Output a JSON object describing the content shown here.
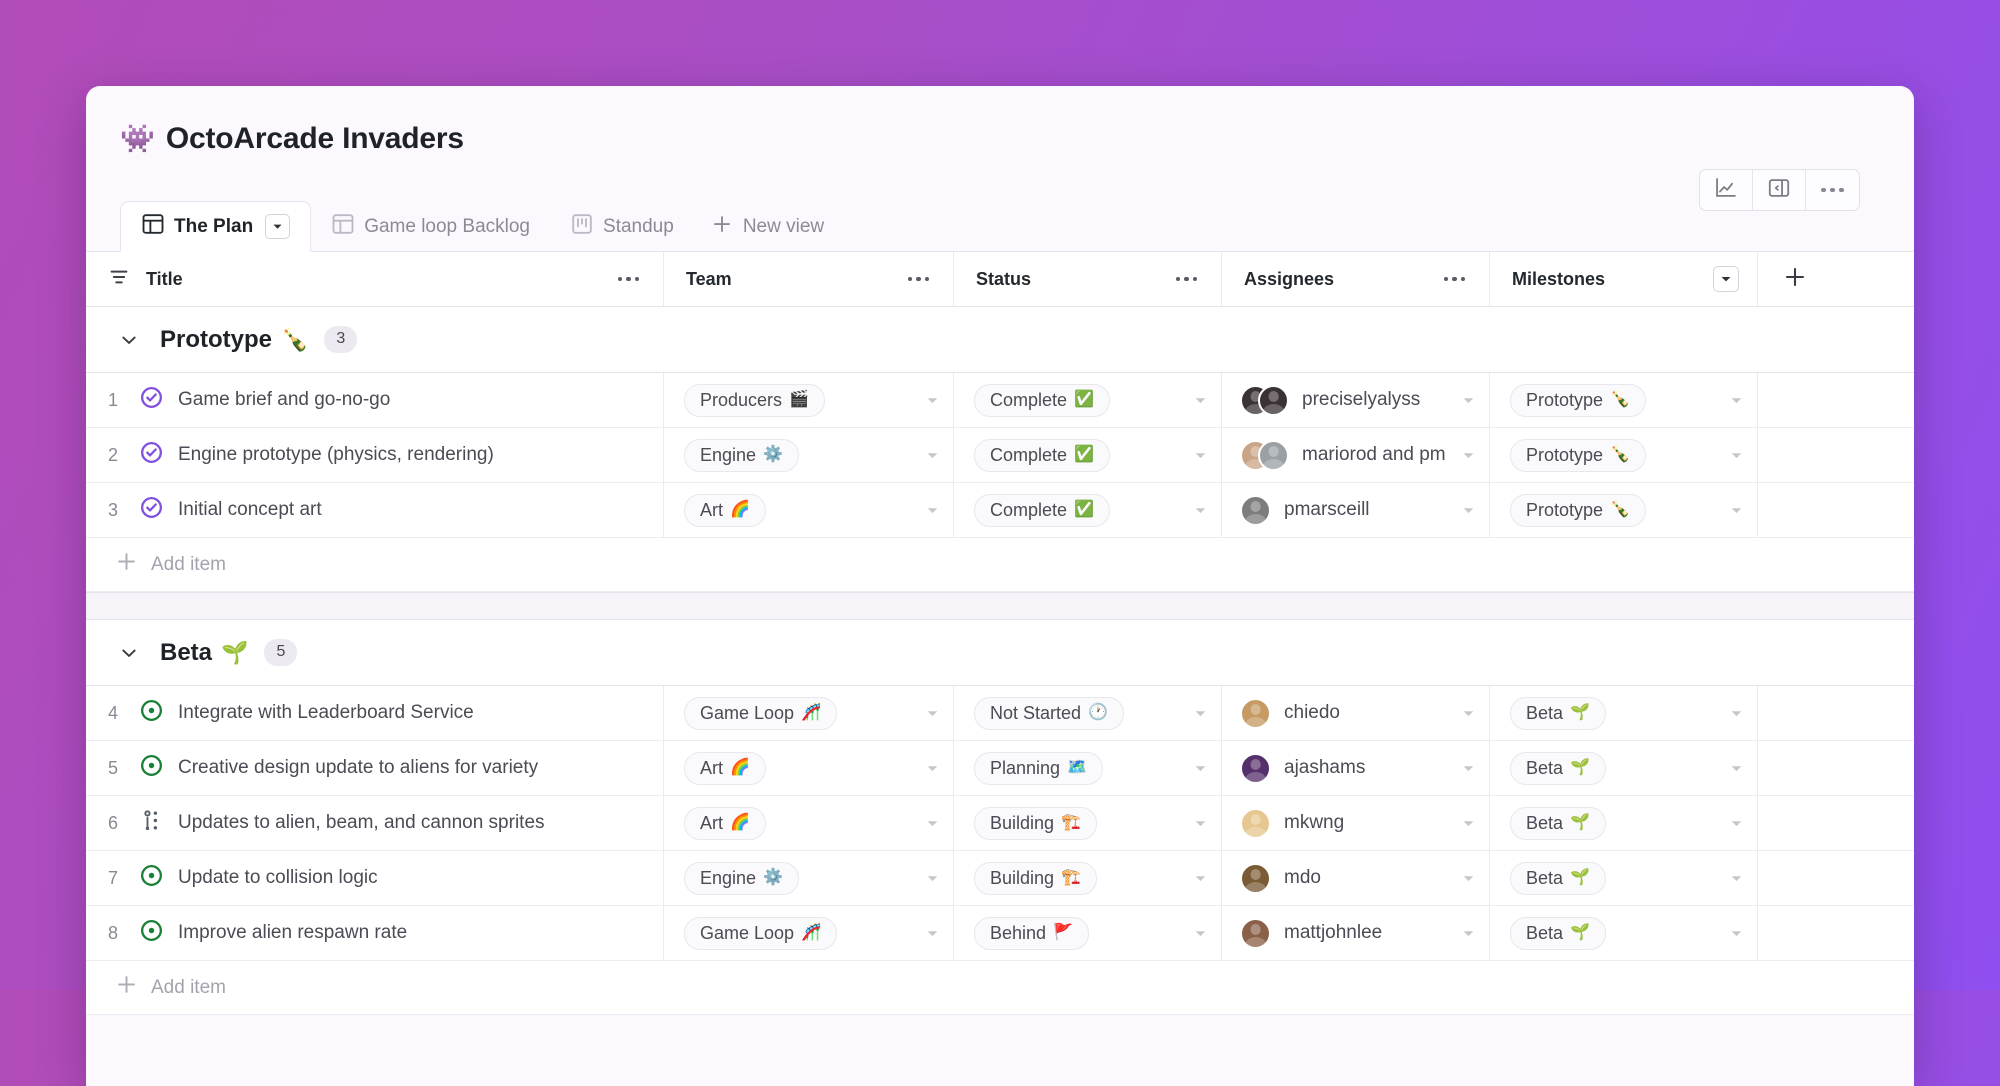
{
  "header": {
    "emoji": "👾",
    "title": "OctoArcade Invaders",
    "actions": [
      {
        "name": "insights-icon",
        "label": "Insights"
      },
      {
        "name": "side-panel-icon",
        "label": "Toggle side panel"
      },
      {
        "name": "more-options-icon",
        "label": "More options"
      }
    ]
  },
  "tabs": {
    "items": [
      {
        "label": "The Plan",
        "icon": "table-view-icon",
        "active": true,
        "has_caret": true
      },
      {
        "label": "Game loop Backlog",
        "icon": "table-view-icon",
        "active": false,
        "has_caret": false
      },
      {
        "label": "Standup",
        "icon": "board-view-icon",
        "active": false,
        "has_caret": false
      }
    ],
    "new_view_label": "New view"
  },
  "table": {
    "columns": [
      {
        "label": "Title",
        "has_filter_icon": true,
        "has_dots": true
      },
      {
        "label": "Team",
        "has_dots": true
      },
      {
        "label": "Status",
        "has_dots": true
      },
      {
        "label": "Assignees",
        "has_dots": true
      },
      {
        "label": "Milestones",
        "has_caret": true
      }
    ],
    "add_column_label": "+",
    "add_item_label": "Add item"
  },
  "groups": [
    {
      "name": "Prototype",
      "emoji": "🍾",
      "count": "3",
      "rows": [
        {
          "num": "1",
          "icon": "issue-closed-completed-icon",
          "icon_color": "#8250df",
          "title": "Game brief and go-no-go",
          "team": {
            "label": "Producers",
            "emoji": "🎬"
          },
          "status": {
            "label": "Complete",
            "emoji": "✅"
          },
          "assignees": {
            "name": "preciselyalyss",
            "avatars": [
              "#3b3236",
              "#3b3236"
            ],
            "count": 1
          },
          "milestone": {
            "label": "Prototype",
            "emoji": "🍾"
          }
        },
        {
          "num": "2",
          "icon": "issue-closed-completed-icon",
          "icon_color": "#8250df",
          "title": "Engine prototype (physics, rendering)",
          "team": {
            "label": "Engine",
            "emoji": "⚙️"
          },
          "status": {
            "label": "Complete",
            "emoji": "✅"
          },
          "assignees": {
            "name": "mariorod and pm",
            "avatars": [
              "#c9a587",
              "#9aa0a4"
            ],
            "count": 2
          },
          "milestone": {
            "label": "Prototype",
            "emoji": "🍾"
          }
        },
        {
          "num": "3",
          "icon": "issue-closed-completed-icon",
          "icon_color": "#8250df",
          "title": "Initial concept art",
          "team": {
            "label": "Art",
            "emoji": "🌈"
          },
          "status": {
            "label": "Complete",
            "emoji": "✅"
          },
          "assignees": {
            "name": "pmarsceill",
            "avatars": [
              "#7d7d7d"
            ],
            "count": 1
          },
          "milestone": {
            "label": "Prototype",
            "emoji": "🍾"
          }
        }
      ]
    },
    {
      "name": "Beta",
      "emoji": "🌱",
      "count": "5",
      "rows": [
        {
          "num": "4",
          "icon": "issue-open-icon",
          "icon_color": "#1a7f37",
          "title": "Integrate with Leaderboard Service",
          "team": {
            "label": "Game Loop",
            "emoji": "🎢"
          },
          "status": {
            "label": "Not Started",
            "emoji": "🕐"
          },
          "assignees": {
            "name": "chiedo",
            "avatars": [
              "#c69a63"
            ],
            "count": 1
          },
          "milestone": {
            "label": "Beta",
            "emoji": "🌱"
          }
        },
        {
          "num": "5",
          "icon": "issue-open-icon",
          "icon_color": "#1a7f37",
          "title": "Creative design update to aliens for variety",
          "team": {
            "label": "Art",
            "emoji": "🌈"
          },
          "status": {
            "label": "Planning",
            "emoji": "🗺️"
          },
          "assignees": {
            "name": "ajashams",
            "avatars": [
              "#56306b"
            ],
            "count": 1
          },
          "milestone": {
            "label": "Beta",
            "emoji": "🌱"
          }
        },
        {
          "num": "6",
          "icon": "issue-draft-icon",
          "icon_color": "#57606a",
          "title": "Updates to alien, beam, and cannon sprites",
          "team": {
            "label": "Art",
            "emoji": "🌈"
          },
          "status": {
            "label": "Building",
            "emoji": "🏗️"
          },
          "assignees": {
            "name": "mkwng",
            "avatars": [
              "#e6c78f"
            ],
            "count": 1
          },
          "milestone": {
            "label": "Beta",
            "emoji": "🌱"
          }
        },
        {
          "num": "7",
          "icon": "issue-open-icon",
          "icon_color": "#1a7f37",
          "title": "Update to collision logic",
          "team": {
            "label": "Engine",
            "emoji": "⚙️"
          },
          "status": {
            "label": "Building",
            "emoji": "🏗️"
          },
          "assignees": {
            "name": "mdo",
            "avatars": [
              "#7a5b36"
            ],
            "count": 1
          },
          "milestone": {
            "label": "Beta",
            "emoji": "🌱"
          }
        },
        {
          "num": "8",
          "icon": "issue-open-icon",
          "icon_color": "#1a7f37",
          "title": "Improve alien respawn rate",
          "team": {
            "label": "Game Loop",
            "emoji": "🎢"
          },
          "status": {
            "label": "Behind",
            "emoji": "🚩"
          },
          "assignees": {
            "name": "mattjohnlee",
            "avatars": [
              "#8a6048"
            ],
            "count": 1
          },
          "milestone": {
            "label": "Beta",
            "emoji": "🌱"
          }
        }
      ]
    }
  ],
  "colors": {
    "background_start": "#b24cb8",
    "background_end": "#8f4ef0",
    "closed_purple": "#8250df",
    "open_green": "#1a7f37",
    "card": "#ffffff"
  }
}
